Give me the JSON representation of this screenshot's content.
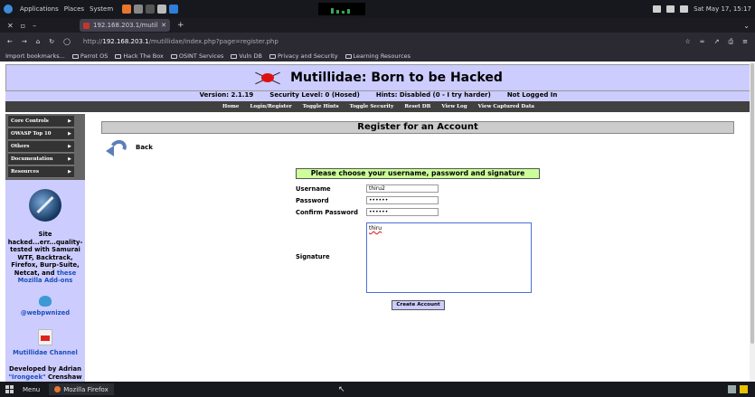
{
  "os_panel": {
    "menus": [
      "Applications",
      "Places",
      "System"
    ],
    "clock": "Sat May 17, 15:17"
  },
  "browser": {
    "tab_title": "192.168.203.1/mutillidae",
    "url_prefix": "http://",
    "url_host": "192.168.203.1",
    "url_path": "/mutillidae/index.php?page=register.php",
    "bookmarks": [
      "Import bookmarks...",
      "Parrot OS",
      "Hack The Box",
      "OSINT Services",
      "Vuln DB",
      "Privacy and Security",
      "Learning Resources"
    ]
  },
  "page": {
    "site_title": "Mutillidae: Born to be Hacked",
    "version": "Version: 2.1.19",
    "security_level": "Security Level: 0 (Hosed)",
    "hints": "Hints: Disabled (0 - I try harder)",
    "login_status": "Not Logged In",
    "top_nav": [
      "Home",
      "Login/Register",
      "Toggle Hints",
      "Toggle Security",
      "Reset DB",
      "View Log",
      "View Captured Data"
    ],
    "side_menu": [
      "Core Controls",
      "OWASP Top 10",
      "Others",
      "Documentation",
      "Resources"
    ],
    "side_text_main": "Site hacked...err...quality-tested with Samurai WTF, Backtrack, Firefox, Burp-Suite, Netcat, and",
    "side_text_link": "these Mozilla Add-ons",
    "twitter_handle": "@webpwnized",
    "channel": "Mutillidae Channel",
    "developed_by": "Developed by Adrian",
    "developer_link": "\"Irongeek\"",
    "developer_tail": " Crenshaw",
    "page_title": "Register for an Account",
    "back_label": "Back",
    "form_heading": "Please choose your username, password and signature",
    "labels": {
      "username": "Username",
      "password": "Password",
      "confirm": "Confirm Password",
      "signature": "Signature"
    },
    "values": {
      "username": "thiru2",
      "password": "••••••",
      "confirm": "••••••",
      "signature": "thiru"
    },
    "create_button": "Create Account"
  },
  "taskbar": {
    "menu_label": "Menu",
    "task_label": "Mozilla Firefox"
  },
  "colors": {
    "header_bg": "#ccccff",
    "nav_bg": "#404040",
    "form_head_bg": "#ccff99",
    "link": "#1a4fb8"
  }
}
